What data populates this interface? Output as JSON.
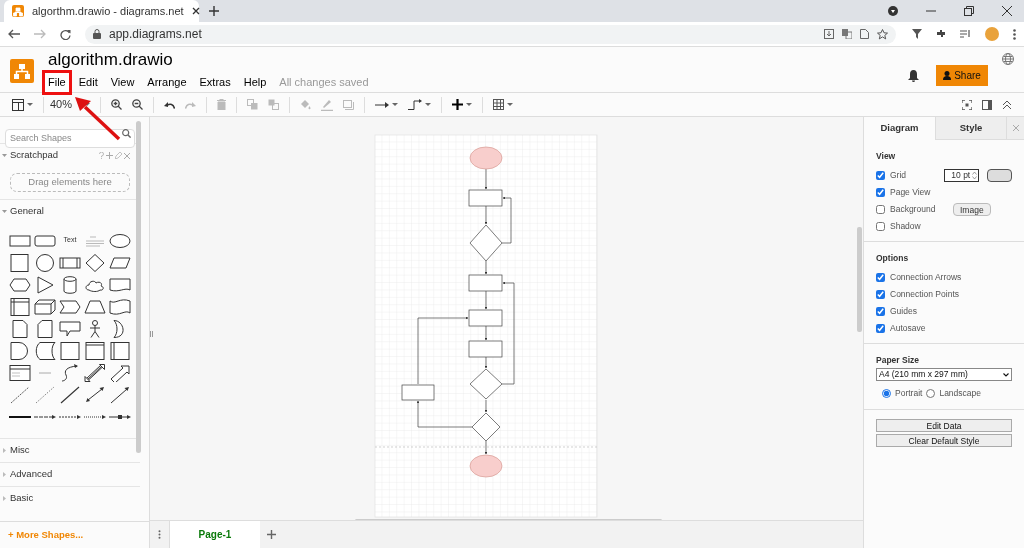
{
  "browser": {
    "tab_title": "algorthm.drawio - diagrams.net",
    "url": "app.diagrams.net"
  },
  "app": {
    "title": "algorithm.drawio",
    "menu": [
      {
        "label": "File",
        "highlighted": true
      },
      {
        "label": "Edit",
        "highlighted": false
      },
      {
        "label": "View",
        "highlighted": false
      },
      {
        "label": "Arrange",
        "highlighted": false
      },
      {
        "label": "Extras",
        "highlighted": false
      },
      {
        "label": "Help",
        "highlighted": false
      }
    ],
    "status": "All changes saved",
    "share_button": "Share"
  },
  "toolbar": {
    "zoom": "40%"
  },
  "sidebar": {
    "search": {
      "placeholder": "Search Shapes"
    },
    "sections": [
      {
        "label": "Scratchpad",
        "kind": "scratchpad",
        "expanded": true,
        "drop_hint": "Drag elements here"
      },
      {
        "label": "General",
        "kind": "palette",
        "expanded": true,
        "text_shape": "Text"
      },
      {
        "label": "Misc",
        "kind": "palette",
        "expanded": false
      },
      {
        "label": "Advanced",
        "kind": "palette",
        "expanded": false
      },
      {
        "label": "Basic",
        "kind": "palette",
        "expanded": false
      }
    ],
    "more_shapes": "+ More Shapes..."
  },
  "page_tabs": [
    {
      "label": "Page-1",
      "selected": true
    }
  ],
  "format_panel": {
    "tabs": [
      {
        "label": "Diagram",
        "selected": true
      },
      {
        "label": "Style",
        "selected": false
      }
    ],
    "view": {
      "title": "View",
      "options": [
        {
          "label": "Grid",
          "checked": true,
          "kind": "grid",
          "value": "10 pt"
        },
        {
          "label": "Page View",
          "checked": true,
          "kind": "plain"
        },
        {
          "label": "Background",
          "checked": false,
          "kind": "image",
          "button": "Image"
        },
        {
          "label": "Shadow",
          "checked": false,
          "kind": "plain"
        }
      ]
    },
    "options": {
      "title": "Options",
      "items": [
        {
          "label": "Connection Arrows",
          "checked": true
        },
        {
          "label": "Connection Points",
          "checked": true
        },
        {
          "label": "Guides",
          "checked": true
        },
        {
          "label": "Autosave",
          "checked": true
        }
      ]
    },
    "paper": {
      "title": "Paper Size",
      "size": "A4 (210 mm x 297 mm)",
      "orientations": [
        {
          "label": "Portrait",
          "selected": true
        },
        {
          "label": "Landscape",
          "selected": false
        }
      ]
    },
    "buttons": [
      "Edit Data",
      "Clear Default Style"
    ]
  }
}
